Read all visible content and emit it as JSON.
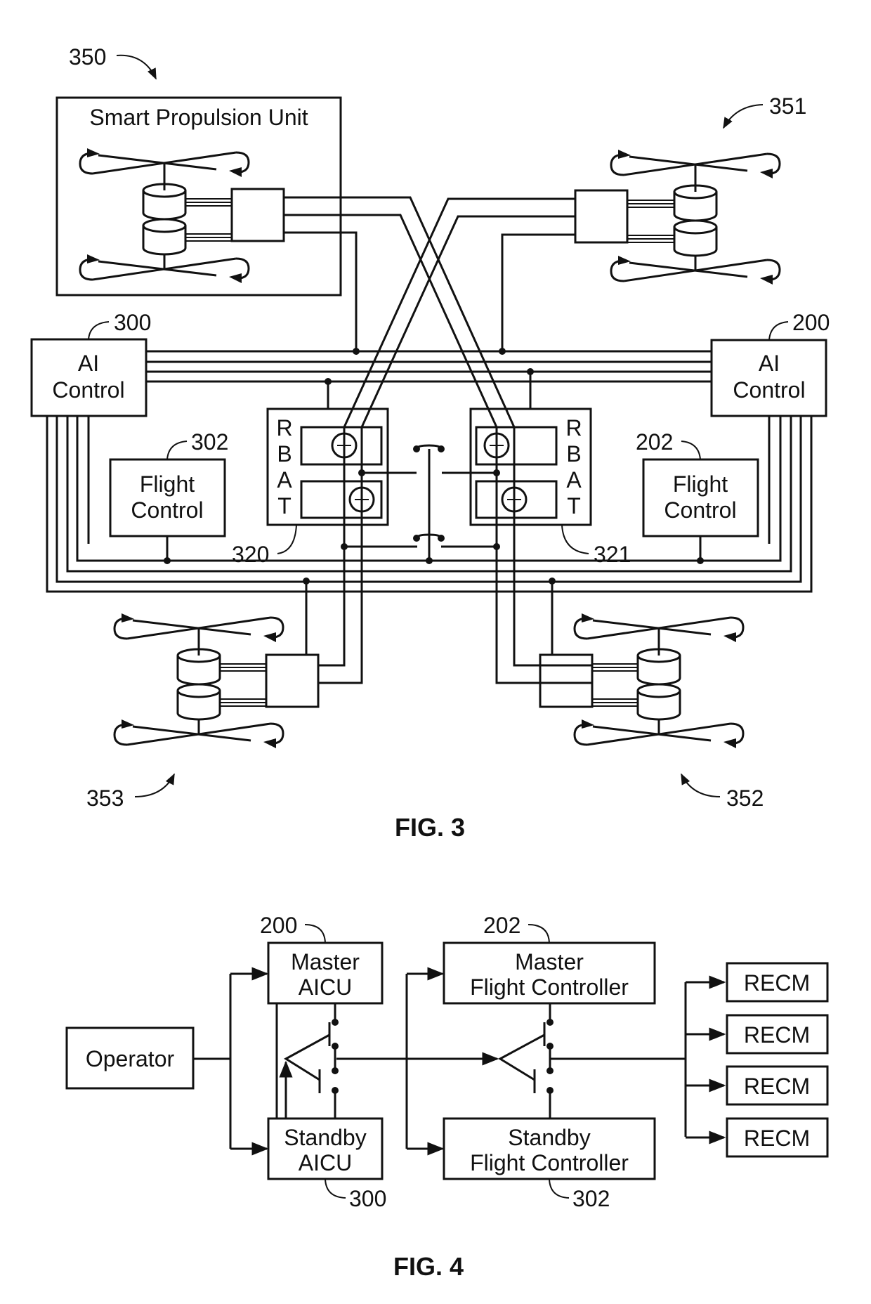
{
  "colors": {
    "ink": "#111111",
    "paper": "#ffffff"
  },
  "fig3": {
    "caption": "FIG. 3",
    "propulsion_unit_title": "Smart Propulsion Unit",
    "refs": {
      "spu_top_left": "350",
      "spu_top_right": "351",
      "spu_bottom_right": "352",
      "spu_bottom_left": "353",
      "ai_left": "300",
      "ai_right": "200",
      "fc_left": "302",
      "fc_right": "202",
      "rbat_left": "320",
      "rbat_right": "321"
    },
    "ai_control_left": {
      "line1": "AI",
      "line2": "Control"
    },
    "ai_control_right": {
      "line1": "AI",
      "line2": "Control"
    },
    "flight_control_left": {
      "line1": "Flight",
      "line2": "Control"
    },
    "flight_control_right": {
      "line1": "Flight",
      "line2": "Control"
    },
    "rbat_letters": [
      "R",
      "B",
      "A",
      "T"
    ]
  },
  "fig4": {
    "caption": "FIG. 4",
    "operator": "Operator",
    "master_aicu": {
      "line1": "Master",
      "line2": "AICU",
      "ref": "200"
    },
    "standby_aicu": {
      "line1": "Standby",
      "line2": "AICU",
      "ref": "300"
    },
    "master_fc": {
      "line1": "Master",
      "line2": "Flight Controller",
      "ref": "202"
    },
    "standby_fc": {
      "line1": "Standby",
      "line2": "Flight Controller",
      "ref": "302"
    },
    "recm": [
      "RECM",
      "RECM",
      "RECM",
      "RECM"
    ]
  }
}
